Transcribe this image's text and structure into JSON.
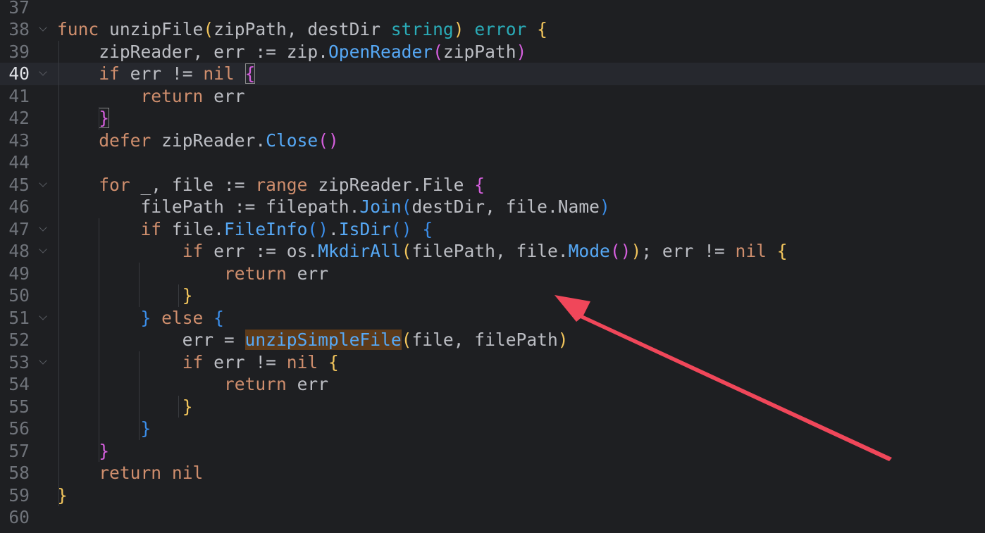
{
  "colors": {
    "background": "#1e1f22",
    "current_line": "#26282e",
    "keyword": "#cf8e6d",
    "function": "#56a8f5",
    "type": "#2aacb8",
    "bracket_yellow": "#f2c55c",
    "bracket_pink": "#d55fde",
    "bracket_blue": "#3b8eea",
    "plain": "#bcbec4",
    "line_number": "#6f737a",
    "arrow": "#f0475a"
  },
  "current_line": "40",
  "lines": [
    {
      "num": "37",
      "fold": false,
      "tokens": []
    },
    {
      "num": "38",
      "fold": true,
      "tokens": [
        {
          "t": "func ",
          "c": "keyword"
        },
        {
          "t": "unzipFile",
          "c": "plain"
        },
        {
          "t": "(",
          "c": "bracket_yellow"
        },
        {
          "t": "zipPath, destDir ",
          "c": "plain"
        },
        {
          "t": "string",
          "c": "type"
        },
        {
          "t": ") ",
          "c": "bracket_yellow"
        },
        {
          "t": "error ",
          "c": "type"
        },
        {
          "t": "{",
          "c": "bracket_yellow"
        }
      ]
    },
    {
      "num": "39",
      "fold": false,
      "tokens": [
        {
          "t": "    zipReader, err := zip.",
          "c": "plain"
        },
        {
          "t": "OpenReader",
          "c": "function"
        },
        {
          "t": "(",
          "c": "bracket_pink"
        },
        {
          "t": "zipPath",
          "c": "plain"
        },
        {
          "t": ")",
          "c": "bracket_pink"
        }
      ]
    },
    {
      "num": "40",
      "fold": true,
      "tokens": [
        {
          "t": "    ",
          "c": "plain"
        },
        {
          "t": "if ",
          "c": "keyword"
        },
        {
          "t": "err != ",
          "c": "plain"
        },
        {
          "t": "nil ",
          "c": "keyword"
        },
        {
          "t": "{",
          "c": "bracket_pink",
          "match": true
        }
      ]
    },
    {
      "num": "41",
      "fold": false,
      "tokens": [
        {
          "t": "        ",
          "c": "plain"
        },
        {
          "t": "return ",
          "c": "keyword"
        },
        {
          "t": "err",
          "c": "plain"
        }
      ]
    },
    {
      "num": "42",
      "fold": false,
      "tokens": [
        {
          "t": "    ",
          "c": "plain"
        },
        {
          "t": "}",
          "c": "bracket_pink",
          "match": true
        }
      ]
    },
    {
      "num": "43",
      "fold": false,
      "tokens": [
        {
          "t": "    ",
          "c": "plain"
        },
        {
          "t": "defer ",
          "c": "keyword"
        },
        {
          "t": "zipReader.",
          "c": "plain"
        },
        {
          "t": "Close",
          "c": "function"
        },
        {
          "t": "()",
          "c": "bracket_pink"
        }
      ]
    },
    {
      "num": "44",
      "fold": false,
      "tokens": []
    },
    {
      "num": "45",
      "fold": true,
      "tokens": [
        {
          "t": "    ",
          "c": "plain"
        },
        {
          "t": "for ",
          "c": "keyword"
        },
        {
          "t": "_, file := ",
          "c": "plain"
        },
        {
          "t": "range ",
          "c": "keyword"
        },
        {
          "t": "zipReader.File ",
          "c": "plain"
        },
        {
          "t": "{",
          "c": "bracket_pink"
        }
      ]
    },
    {
      "num": "46",
      "fold": false,
      "tokens": [
        {
          "t": "        filePath := filepath.",
          "c": "plain"
        },
        {
          "t": "Join",
          "c": "function"
        },
        {
          "t": "(",
          "c": "bracket_blue"
        },
        {
          "t": "destDir, file.Name",
          "c": "plain"
        },
        {
          "t": ")",
          "c": "bracket_blue"
        }
      ]
    },
    {
      "num": "47",
      "fold": true,
      "tokens": [
        {
          "t": "        ",
          "c": "plain"
        },
        {
          "t": "if ",
          "c": "keyword"
        },
        {
          "t": "file.",
          "c": "plain"
        },
        {
          "t": "FileInfo",
          "c": "function"
        },
        {
          "t": "()",
          "c": "bracket_blue"
        },
        {
          "t": ".",
          "c": "plain"
        },
        {
          "t": "IsDir",
          "c": "function"
        },
        {
          "t": "() ",
          "c": "bracket_blue"
        },
        {
          "t": "{",
          "c": "bracket_blue"
        }
      ]
    },
    {
      "num": "48",
      "fold": true,
      "tokens": [
        {
          "t": "            ",
          "c": "plain"
        },
        {
          "t": "if ",
          "c": "keyword"
        },
        {
          "t": "err := os.",
          "c": "plain"
        },
        {
          "t": "MkdirAll",
          "c": "function"
        },
        {
          "t": "(",
          "c": "bracket_yellow"
        },
        {
          "t": "filePath, file.",
          "c": "plain"
        },
        {
          "t": "Mode",
          "c": "function"
        },
        {
          "t": "()",
          "c": "bracket_pink"
        },
        {
          "t": ")",
          "c": "bracket_yellow"
        },
        {
          "t": "; err != ",
          "c": "plain"
        },
        {
          "t": "nil ",
          "c": "keyword"
        },
        {
          "t": "{",
          "c": "bracket_yellow"
        }
      ]
    },
    {
      "num": "49",
      "fold": false,
      "tokens": [
        {
          "t": "                ",
          "c": "plain"
        },
        {
          "t": "return ",
          "c": "keyword"
        },
        {
          "t": "err",
          "c": "plain"
        }
      ]
    },
    {
      "num": "50",
      "fold": false,
      "tokens": [
        {
          "t": "            ",
          "c": "plain"
        },
        {
          "t": "}",
          "c": "bracket_yellow"
        }
      ]
    },
    {
      "num": "51",
      "fold": true,
      "tokens": [
        {
          "t": "        ",
          "c": "plain"
        },
        {
          "t": "} ",
          "c": "bracket_blue"
        },
        {
          "t": "else ",
          "c": "keyword"
        },
        {
          "t": "{",
          "c": "bracket_blue"
        }
      ]
    },
    {
      "num": "52",
      "fold": false,
      "tokens": [
        {
          "t": "            err = ",
          "c": "plain"
        },
        {
          "t": "unzipSimpleFile",
          "c": "function",
          "hl": true
        },
        {
          "t": "(",
          "c": "bracket_yellow"
        },
        {
          "t": "file, filePath",
          "c": "plain"
        },
        {
          "t": ")",
          "c": "bracket_yellow"
        }
      ]
    },
    {
      "num": "53",
      "fold": true,
      "tokens": [
        {
          "t": "            ",
          "c": "plain"
        },
        {
          "t": "if ",
          "c": "keyword"
        },
        {
          "t": "err != ",
          "c": "plain"
        },
        {
          "t": "nil ",
          "c": "keyword"
        },
        {
          "t": "{",
          "c": "bracket_yellow"
        }
      ]
    },
    {
      "num": "54",
      "fold": false,
      "tokens": [
        {
          "t": "                ",
          "c": "plain"
        },
        {
          "t": "return ",
          "c": "keyword"
        },
        {
          "t": "err",
          "c": "plain"
        }
      ]
    },
    {
      "num": "55",
      "fold": false,
      "tokens": [
        {
          "t": "            ",
          "c": "plain"
        },
        {
          "t": "}",
          "c": "bracket_yellow"
        }
      ]
    },
    {
      "num": "56",
      "fold": false,
      "tokens": [
        {
          "t": "        ",
          "c": "plain"
        },
        {
          "t": "}",
          "c": "bracket_blue"
        }
      ]
    },
    {
      "num": "57",
      "fold": false,
      "tokens": [
        {
          "t": "    ",
          "c": "plain"
        },
        {
          "t": "}",
          "c": "bracket_pink"
        }
      ]
    },
    {
      "num": "58",
      "fold": false,
      "tokens": [
        {
          "t": "    ",
          "c": "plain"
        },
        {
          "t": "return ",
          "c": "keyword"
        },
        {
          "t": "nil",
          "c": "keyword"
        }
      ]
    },
    {
      "num": "59",
      "fold": false,
      "tokens": [
        {
          "t": "}",
          "c": "bracket_yellow"
        }
      ]
    },
    {
      "num": "60",
      "fold": false,
      "tokens": []
    }
  ]
}
